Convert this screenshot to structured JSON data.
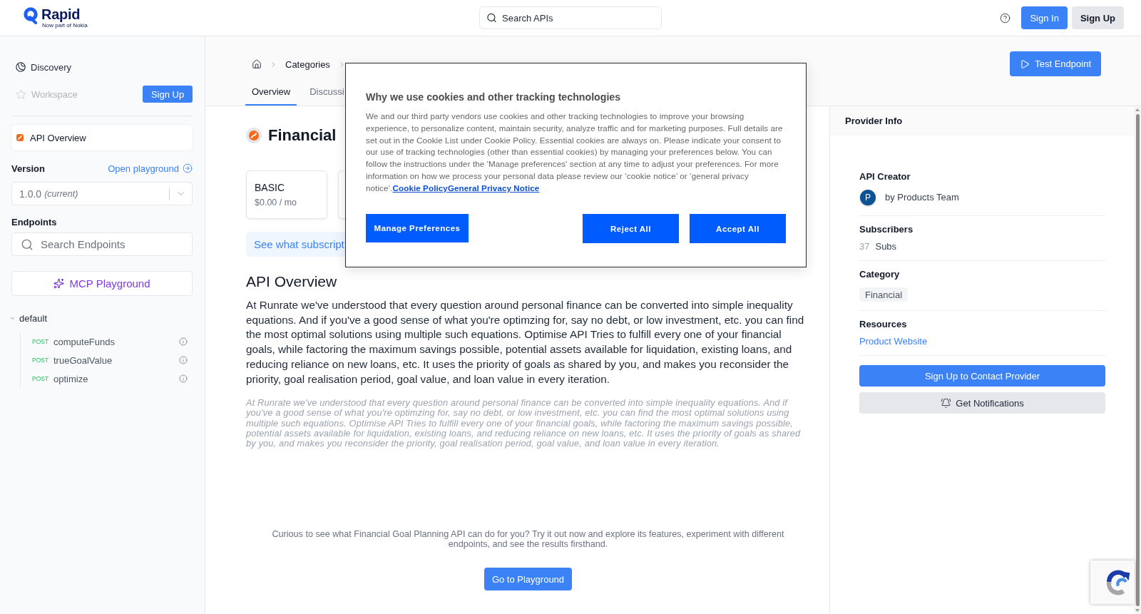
{
  "header": {
    "logo": {
      "name": "Rapid",
      "tagline": "Now part of Nokia"
    },
    "search": {
      "placeholder": "Search APIs"
    },
    "buttons": [
      {
        "label": "Sign In",
        "kind": "primary"
      },
      {
        "label": "Sign Up",
        "kind": "secondary"
      }
    ]
  },
  "sidebar": {
    "nav": [
      {
        "label": "Discovery",
        "disabled": false
      },
      {
        "label": "Workspace",
        "disabled": true
      }
    ],
    "signup_button": "Sign Up",
    "overview_item": {
      "label": "API Overview",
      "selected": true
    },
    "version": {
      "label": "Version",
      "link": "Open playground",
      "value": "1.0.0",
      "note": "(current)"
    },
    "endpoints": {
      "label": "Endpoints",
      "search": {
        "placeholder": "Search Endpoints"
      },
      "mcp_button": "MCP Playground",
      "groups": [
        {
          "name": "default",
          "expanded": true,
          "children": [
            {
              "method": "POST",
              "name": "computeFunds",
              "selected": false
            },
            {
              "method": "POST",
              "name": "trueGoalValue",
              "selected": false
            },
            {
              "method": "POST",
              "name": "optimize",
              "selected": false
            }
          ]
        }
      ]
    }
  },
  "breadcrumb": {
    "items": [
      "Categories"
    ]
  },
  "tabs": [
    {
      "label": "Overview",
      "selected": true
    },
    {
      "label": "Discussi",
      "selected": false
    }
  ],
  "test_endpoint_button": "Test Endpoint",
  "api": {
    "title": "Financial",
    "plans": [
      {
        "name": "BASIC",
        "price": "$0.00 / mo"
      }
    ],
    "subscription_banner": "See what subscript",
    "overview": {
      "heading": "API Overview",
      "description": "At Runrate we've understood that every question around personal finance can be converted into simple inequality equations. And if you've a good sense of what you're optimzing for, say no debt, or low investment, etc. you can find the most optimal solutions using multiple such equations. Optimise API Tries to fulfill every one of your financial goals, while factoring the maximum savings possible, potential assets available for liquidation, existing loans, and reducing reliance on new loans, etc. It uses the priority of goals as shared by you, and makes you reconsider the priority, goal realisation period, goal value, and loan value in every iteration.",
      "long_description": "At Runrate we've understood that every question around personal finance can be converted into simple inequality equations. And if you've a good sense of what you're optimzing for, say no debt, or low investment, etc. you can find the most optimal solutions using multiple such equations. Optimise API Tries to fulfill every one of your financial goals, while factoring the maximum savings possible, potential assets available for liquidation, existing loans, and reducing reliance on new loans, etc. It uses the priority of goals as shared by you, and makes you reconsider the priority, goal realisation period, goal value, and loan value in every iteration."
    },
    "cta": {
      "text": "Curious to see what Financial Goal Planning API can do for you? Try it out now and explore its features, experiment with different endpoints, and see the results firsthand.",
      "button": "Go to Playground"
    }
  },
  "provider_info": {
    "title": "Provider Info",
    "sections": [
      {
        "kind": "creator",
        "label": "API Creator",
        "avatar": "P",
        "text": "by Products Team"
      },
      {
        "kind": "count",
        "label": "Subscribers",
        "count": "37",
        "unit": "Subs"
      },
      {
        "kind": "tag",
        "label": "Category",
        "tag": "Financial"
      },
      {
        "kind": "link",
        "label": "Resources",
        "link": "Product Website"
      }
    ],
    "buttons": [
      {
        "label": "Sign Up to Contact Provider",
        "kind": "primary"
      },
      {
        "label": "Get Notifications",
        "kind": "notify"
      }
    ]
  },
  "cookie_dialog": {
    "title": "Why we use cookies and other tracking technologies",
    "body": "We and our third party vendors use cookies and other tracking technologies to improve your browsing experience, to personalize content, maintain security, analyze traffic and for marketing purposes. Full details are set out in the Cookie List under Cookie Policy. Essential cookies are always on. Please indicate your consent to our use of tracking technologies (other than essential cookies) by managing your preferences below. You can follow the instructions under the 'Manage preferences' section at any time to adjust your preferences. For more information on how we process your personal data please review our ‘cookie notice’ or ‘general privacy notice’.",
    "links": [
      "Cookie Policy",
      "General Privacy Notice"
    ],
    "buttons": [
      {
        "label": "Manage Preferences"
      },
      {
        "label": "Reject All"
      },
      {
        "label": "Accept All"
      }
    ]
  }
}
